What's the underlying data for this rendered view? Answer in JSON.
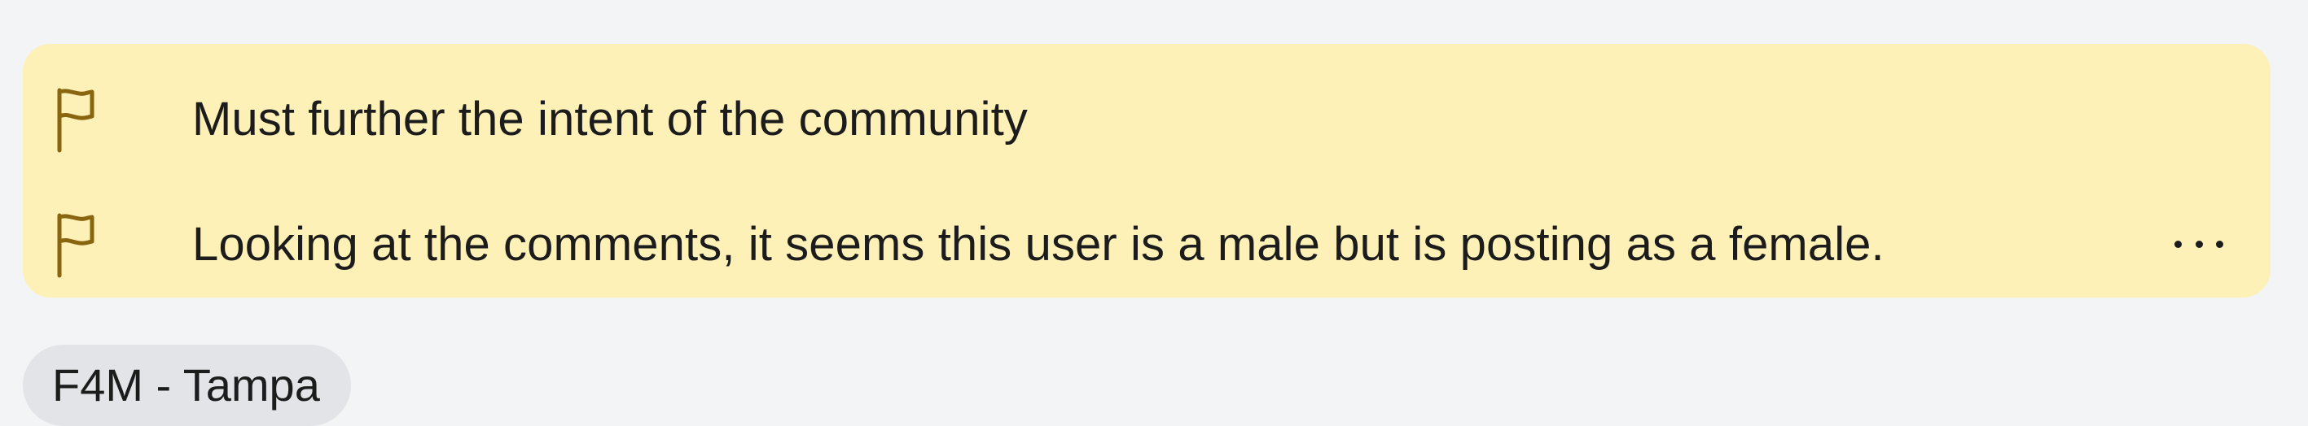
{
  "reports": [
    {
      "icon": "flag-icon",
      "text": "Must further the intent of the community"
    },
    {
      "icon": "flag-icon",
      "text": "Looking at the comments, it seems this user is a male but is posting as a female."
    }
  ],
  "more_icon": "more-horizontal-icon",
  "flair": {
    "label": "F4M - Tampa"
  },
  "colors": {
    "page_background": "#f3f4f6",
    "report_background": "#fdf1b7",
    "flag_stroke": "#8a6510",
    "flair_background": "#e2e4e8",
    "text": "#1c1c1c"
  }
}
